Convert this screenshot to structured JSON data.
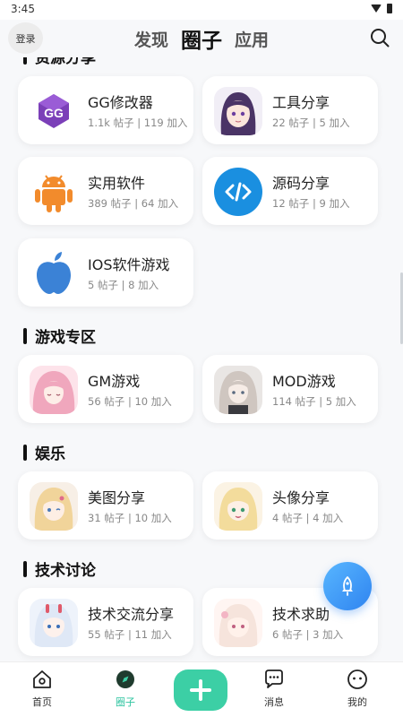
{
  "status": {
    "time": "3:45"
  },
  "header": {
    "login_label": "登录",
    "tabs": [
      {
        "label": "发现"
      },
      {
        "label": "圈子"
      },
      {
        "label": "应用"
      }
    ]
  },
  "sections": [
    {
      "title": "资源分享",
      "cards": [
        {
          "name": "GG修改器",
          "meta": "1.1k 帖子 | 119 加入",
          "icon": "gg-modifier-icon"
        },
        {
          "name": "工具分享",
          "meta": "22 帖子 | 5 加入",
          "icon": "anime-girl-avatar"
        },
        {
          "name": "实用软件",
          "meta": "389 帖子 | 64 加入",
          "icon": "android-icon"
        },
        {
          "name": "源码分享",
          "meta": "12 帖子 | 9 加入",
          "icon": "code-icon"
        },
        {
          "name": "IOS软件游戏",
          "meta": "5 帖子 | 8 加入",
          "icon": "apple-icon"
        }
      ]
    },
    {
      "title": "游戏专区",
      "cards": [
        {
          "name": "GM游戏",
          "meta": "56 帖子 | 10 加入",
          "icon": "anime-girl-avatar"
        },
        {
          "name": "MOD游戏",
          "meta": "114 帖子 | 5 加入",
          "icon": "anime-girl-avatar"
        }
      ]
    },
    {
      "title": "娱乐",
      "cards": [
        {
          "name": "美图分享",
          "meta": "31 帖子 | 10 加入",
          "icon": "anime-girl-avatar"
        },
        {
          "name": "头像分享",
          "meta": "4 帖子 | 4 加入",
          "icon": "anime-girl-avatar"
        }
      ]
    },
    {
      "title": "技术讨论",
      "cards": [
        {
          "name": "技术交流分享",
          "meta": "55 帖子 | 11 加入",
          "icon": "anime-girl-avatar"
        },
        {
          "name": "技术求助",
          "meta": "6 帖子 | 3 加入",
          "icon": "anime-girl-avatar"
        }
      ]
    }
  ],
  "tabbar": {
    "items": [
      {
        "label": "首页",
        "icon": "home-icon"
      },
      {
        "label": "圈子",
        "icon": "compass-icon"
      },
      {
        "label": "消息",
        "icon": "chat-icon"
      },
      {
        "label": "我的",
        "icon": "smile-face-icon"
      }
    ]
  },
  "colors": {
    "accent": "#3ccfa5",
    "fab": "#2f84f0"
  }
}
